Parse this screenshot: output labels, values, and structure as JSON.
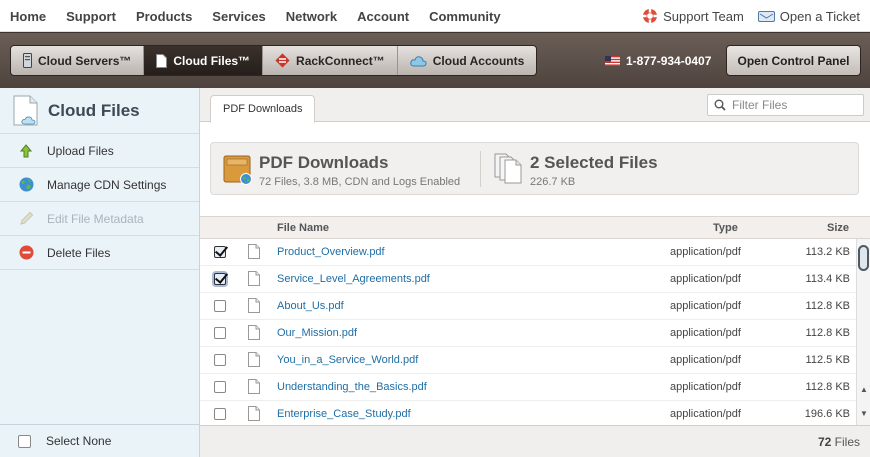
{
  "topnav": {
    "links": [
      "Home",
      "Support",
      "Products",
      "Services",
      "Network",
      "Account",
      "Community"
    ],
    "support_team": "Support Team",
    "open_ticket": "Open a Ticket"
  },
  "productbar": {
    "tabs": [
      "Cloud Servers™",
      "Cloud Files™",
      "RackConnect™",
      "Cloud Accounts"
    ],
    "active_tab": "Cloud Files™",
    "phone": "1-877-934-0407",
    "control_panel": "Open Control Panel"
  },
  "sidebar": {
    "title": "Cloud Files",
    "items": [
      {
        "label": "Upload Files",
        "icon": "up-arrow-icon",
        "disabled": false
      },
      {
        "label": "Manage CDN Settings",
        "icon": "globe-icon",
        "disabled": false
      },
      {
        "label": "Edit File Metadata",
        "icon": "pencil-icon",
        "disabled": true
      },
      {
        "label": "Delete Files",
        "icon": "delete-icon",
        "disabled": false
      }
    ],
    "select_none": "Select None"
  },
  "main": {
    "tab": "PDF Downloads",
    "filter_placeholder": "Filter Files",
    "summary": {
      "container_title": "PDF Downloads",
      "container_sub": "72 Files, 3.8 MB, CDN and Logs Enabled",
      "selected_title": "2 Selected Files",
      "selected_sub": "226.7 KB"
    },
    "columns": {
      "name": "File Name",
      "type": "Type",
      "size": "Size"
    },
    "files": [
      {
        "name": "Product_Overview.pdf",
        "type": "application/pdf",
        "size": "113.2 KB",
        "checked": true
      },
      {
        "name": "Service_Level_Agreements.pdf",
        "type": "application/pdf",
        "size": "113.4 KB",
        "checked": true
      },
      {
        "name": "About_Us.pdf",
        "type": "application/pdf",
        "size": "112.8 KB",
        "checked": false
      },
      {
        "name": "Our_Mission.pdf",
        "type": "application/pdf",
        "size": "112.8 KB",
        "checked": false
      },
      {
        "name": "You_in_a_Service_World.pdf",
        "type": "application/pdf",
        "size": "112.5 KB",
        "checked": false
      },
      {
        "name": "Understanding_the_Basics.pdf",
        "type": "application/pdf",
        "size": "112.8 KB",
        "checked": false
      },
      {
        "name": "Enterprise_Case_Study.pdf",
        "type": "application/pdf",
        "size": "196.6 KB",
        "checked": false
      }
    ],
    "file_count_number": "72",
    "file_count_label": "Files"
  },
  "colors": {
    "brand_bar": "#5a4e48",
    "link": "#1f6ea5",
    "sidebar_bg": "#eaf3f8"
  }
}
